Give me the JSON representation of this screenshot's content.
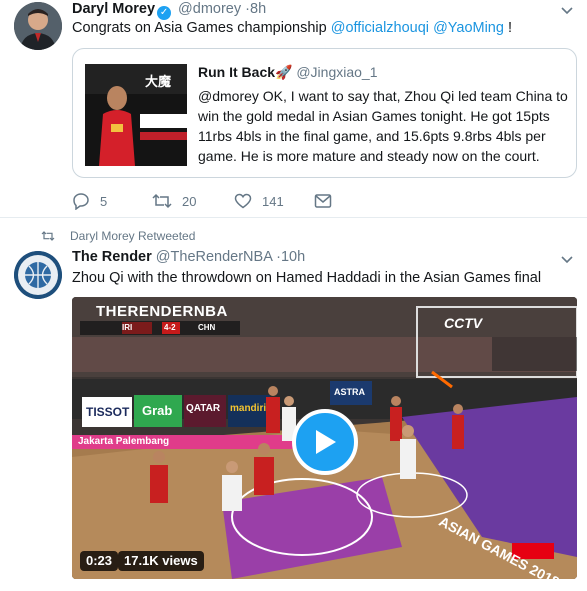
{
  "tweet1": {
    "author_name": "Daryl Morey",
    "handle": "@dmorey",
    "separator": "·",
    "time": "8h",
    "text_prefix": "Congrats on Asia Games championship ",
    "mention1": "@officialzhouqi",
    "mention2": "@YaoMing",
    "text_suffix": " !",
    "quote": {
      "author_name": "Run It Back🚀",
      "handle": "@Jingxiao_1",
      "text": "@dmorey OK, I want to say that, Zhou Qi led team China to win the gold medal in Asian Games tonight. He got 15pts 11rbs 4bls in the final game, and 15.6pts 9.8rbs 4bls per game. He is more mature and steady now on the court."
    },
    "actions": {
      "replies": "5",
      "retweets": "20",
      "likes": "141"
    }
  },
  "retweet_notice": "Daryl Morey Retweeted",
  "tweet2": {
    "author_name": "The Render",
    "handle": "@TheRenderNBA",
    "separator": "·",
    "time": "10h",
    "text": "Zhou Qi with the throwdown on Hamed Haddadi in the Asian Games final",
    "video": {
      "duration": "0:23",
      "views": "17.1K views",
      "watermark": "THERENDERNBA",
      "broadcaster": "CCTV",
      "board_tissot": "TISSOT",
      "board_grab": "Grab",
      "board_qatar": "QATAR",
      "board_mandiri": "mandiri",
      "board_astra": "ASTRA",
      "score_home": "IRI",
      "score_value": "4-2",
      "score_away": "CHN",
      "court_text": "ASIAN GAMES 2018",
      "arena_text": "Jakarta Palembang"
    }
  },
  "colors": {
    "link": "#1b95e0",
    "muted": "#657786",
    "play": "#1da1f2",
    "border": "#e6ecf0"
  }
}
